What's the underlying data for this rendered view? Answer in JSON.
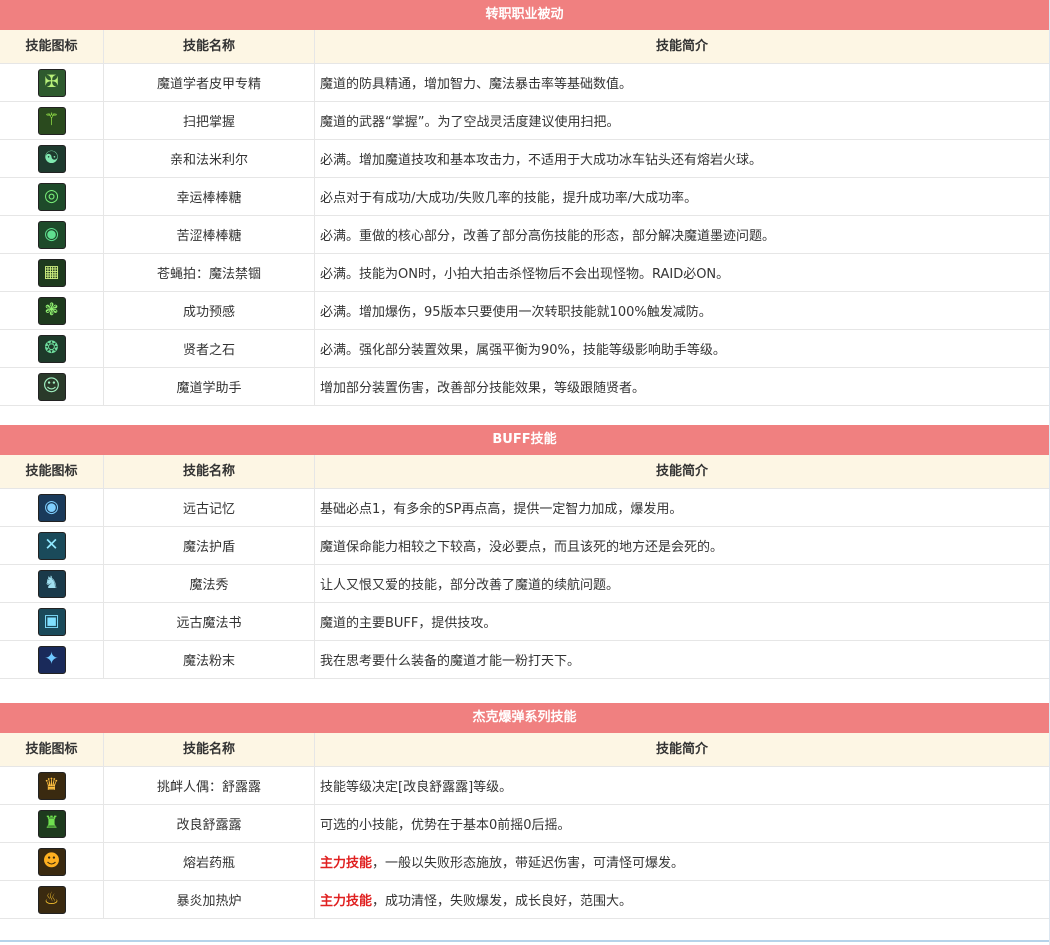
{
  "sections": [
    {
      "title": "转职职业被动",
      "headers": {
        "icon": "技能图标",
        "name": "技能名称",
        "desc": "技能简介"
      },
      "rows": [
        {
          "icon": "sheet-armor-icon",
          "glyph": "✠",
          "bg": "#2e5a2e",
          "fg": "#b8f07a",
          "name": "魔道学者皮甲专精",
          "emph": "",
          "desc": "魔道的防具精通，增加智力、魔法暴击率等基础数值。"
        },
        {
          "icon": "broom-icon",
          "glyph": "⚚",
          "bg": "#2a4a1e",
          "fg": "#a8ff50",
          "name": "扫把掌握",
          "emph": "",
          "desc": "魔道的武器“掌握”。为了空战灵活度建议使用扫把。"
        },
        {
          "icon": "pet-familiar-icon",
          "glyph": "☯",
          "bg": "#1e3a2e",
          "fg": "#80e8b0",
          "name": "亲和法米利尔",
          "emph": "",
          "desc": "必满。增加魔道技攻和基本攻击力，不适用于大成功冰车钻头还有熔岩火球。"
        },
        {
          "icon": "lucky-lollipop-icon",
          "glyph": "◎",
          "bg": "#1e4a2a",
          "fg": "#7af07a",
          "name": "幸运棒棒糖",
          "emph": "",
          "desc": "必点对于有成功/大成功/失败几率的技能，提升成功率/大成功率。"
        },
        {
          "icon": "bitter-lollipop-icon",
          "glyph": "◉",
          "bg": "#1e4a2a",
          "fg": "#60e090",
          "name": "苦涩棒棒糖",
          "emph": "",
          "desc": "必满。重做的核心部分，改善了部分高伤技能的形态，部分解决魔道墨迹问题。"
        },
        {
          "icon": "fly-swatter-icon",
          "glyph": "▦",
          "bg": "#1e3a1e",
          "fg": "#d0f080",
          "name": "苍蝇拍：魔法禁锢",
          "emph": "",
          "desc": "必满。技能为ON时，小拍大拍击杀怪物后不会出现怪物。RAID必ON。"
        },
        {
          "icon": "success-omen-icon",
          "glyph": "❃",
          "bg": "#1e3a1e",
          "fg": "#90f070",
          "name": "成功预感",
          "emph": "",
          "desc": "必满。增加爆伤，95版本只要使用一次转职技能就100%触发减防。"
        },
        {
          "icon": "sage-stone-icon",
          "glyph": "❂",
          "bg": "#1e3a2a",
          "fg": "#70e0a0",
          "name": "贤者之石",
          "emph": "",
          "desc": "必满。强化部分装置效果，属强平衡为90%，技能等级影响助手等级。"
        },
        {
          "icon": "assistant-icon",
          "glyph": "☺",
          "bg": "#2a3a2a",
          "fg": "#a0f0c0",
          "name": "魔道学助手",
          "emph": "",
          "desc": "增加部分装置伤害，改善部分技能效果，等级跟随贤者。"
        }
      ]
    },
    {
      "title": "BUFF技能",
      "headers": {
        "icon": "技能图标",
        "name": "技能名称",
        "desc": "技能简介"
      },
      "rows": [
        {
          "icon": "ancient-memory-icon",
          "glyph": "◉",
          "bg": "#1a3a5a",
          "fg": "#80d0ff",
          "name": "远古记忆",
          "emph": "",
          "desc": "基础必点1，有多余的SP再点高，提供一定智力加成，爆发用。"
        },
        {
          "icon": "magic-shield-icon",
          "glyph": "✕",
          "bg": "#1a4a5a",
          "fg": "#90e8ff",
          "name": "魔法护盾",
          "emph": "",
          "desc": "魔道保命能力相较之下较高，没必要点，而且该死的地方还是会死的。"
        },
        {
          "icon": "magic-show-icon",
          "glyph": "♞",
          "bg": "#1a3a4a",
          "fg": "#a0e0f0",
          "name": "魔法秀",
          "emph": "",
          "desc": "让人又恨又爱的技能，部分改善了魔道的续航问题。"
        },
        {
          "icon": "ancient-grimoire-icon",
          "glyph": "▣",
          "bg": "#1a4a5a",
          "fg": "#80e0ff",
          "name": "远古魔法书",
          "emph": "",
          "desc": "魔道的主要BUFF，提供技攻。"
        },
        {
          "icon": "magic-powder-icon",
          "glyph": "✦",
          "bg": "#1a2a5a",
          "fg": "#70c8ff",
          "name": "魔法粉末",
          "emph": "",
          "desc": "我在思考要什么装备的魔道才能一粉打天下。"
        }
      ]
    },
    {
      "title": "杰克爆弹系列技能",
      "headers": {
        "icon": "技能图标",
        "name": "技能名称",
        "desc": "技能简介"
      },
      "rows": [
        {
          "icon": "shuruluru-doll-icon",
          "glyph": "♛",
          "bg": "#3a2a10",
          "fg": "#ffc040",
          "name": "挑衅人偶：舒露露",
          "emph": "",
          "desc": "技能等级决定[改良舒露露]等级。"
        },
        {
          "icon": "improved-shuruluru-icon",
          "glyph": "♜",
          "bg": "#1e3a1e",
          "fg": "#70e050",
          "name": "改良舒露露",
          "emph": "",
          "desc": "可选的小技能，优势在于基本0前摇0后摇。"
        },
        {
          "icon": "lava-potion-icon",
          "glyph": "☻",
          "bg": "#3a2a10",
          "fg": "#ffb020",
          "name": "熔岩药瓶",
          "emph": "主力技能",
          "desc": "，一般以失败形态施放，带延迟伤害，可清怪可爆发。"
        },
        {
          "icon": "blazing-stove-icon",
          "glyph": "♨",
          "bg": "#3a2a10",
          "fg": "#ffc830",
          "name": "暴炎加热炉",
          "emph": "主力技能",
          "desc": "，成功清怪，失败爆发，成长良好，范围大。"
        }
      ]
    }
  ]
}
